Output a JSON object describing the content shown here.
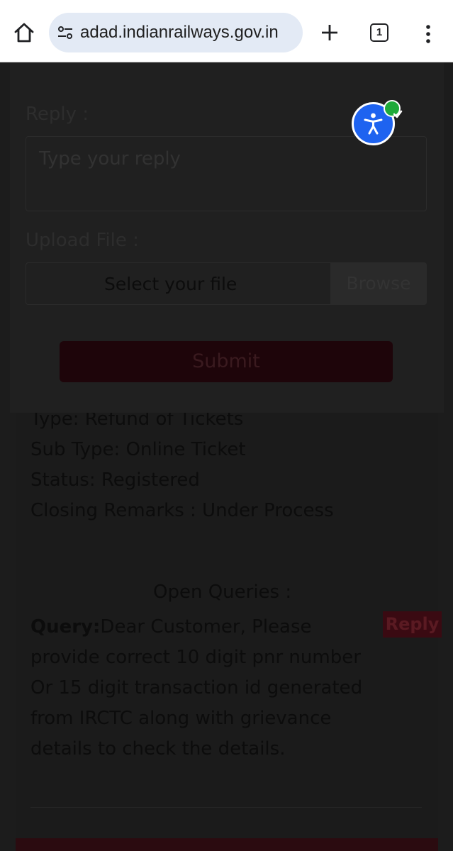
{
  "browser": {
    "url": "adad.indianrailways.gov.in",
    "tab_count": "1"
  },
  "modal": {
    "reply_label": "Reply :",
    "reply_placeholder": "Type your reply",
    "upload_label": "Upload File :",
    "file_placeholder": "Select your file",
    "browse_label": "Browse",
    "submit_label": "Submit"
  },
  "details": {
    "type": "Type: Refund of Tickets",
    "sub_type": "Sub Type: Online Ticket",
    "status": "Status: Registered",
    "closing_remarks": "Closing Remarks : Under Process"
  },
  "queries": {
    "heading": "Open Queries :",
    "query_label": "Query:",
    "query_text": "Dear Customer, Please provide correct 10 digit pnr number Or 15 digit transaction id generated from IRCTC along with grievance details to check the details.",
    "reply_button": "Reply"
  },
  "colors": {
    "url_bar": "#e3eaf5",
    "a11y_blue": "#1e63f0",
    "check_green": "#1faa3a",
    "brand_red": "#3a0a12"
  }
}
